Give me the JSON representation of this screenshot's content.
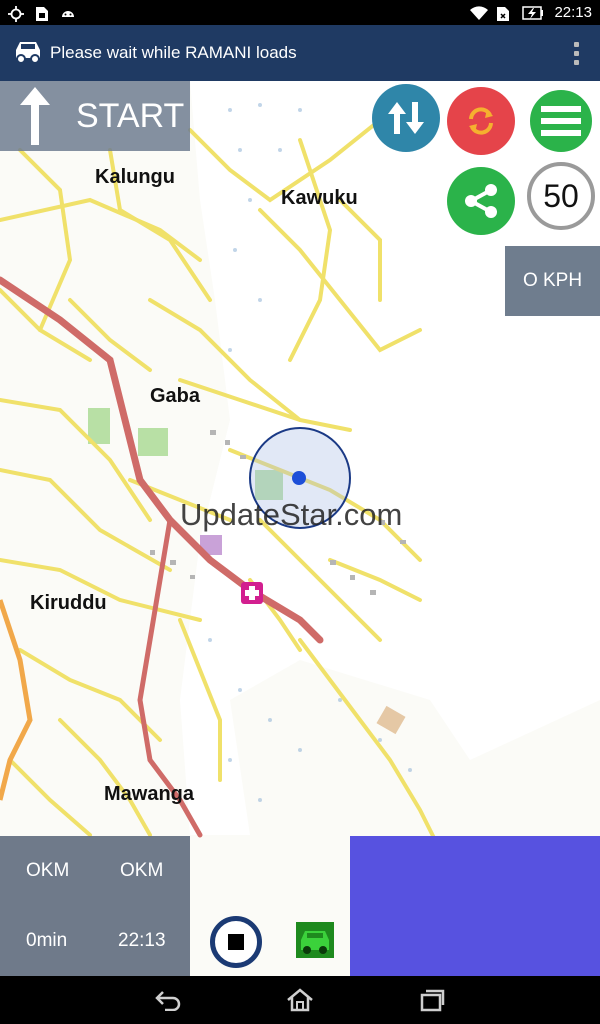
{
  "status_bar": {
    "time": "22:13",
    "icons_left": [
      "gps-icon",
      "sim-icon",
      "android-icon"
    ],
    "icons_right": [
      "wifi-icon",
      "sim-signal-icon",
      "battery-charging-icon"
    ]
  },
  "app_bar": {
    "title": "Please wait while RAMANI loads",
    "icon": "car-icon",
    "menu_icon": "overflow-menu-icon"
  },
  "controls": {
    "start_label": "START",
    "speed_limit": "50",
    "speed": "O KPH",
    "buttons": [
      "swap-arrows-icon",
      "refresh-icon",
      "hamburger-menu-icon",
      "share-icon"
    ]
  },
  "map": {
    "places": [
      "Kalungu",
      "Kawuku",
      "Gaba",
      "Kiruddu",
      "Mawanga"
    ],
    "watermark": "UpdateStar.com",
    "colors": {
      "road_major": "#d76b6b",
      "road_minor": "#f3e36a",
      "water": "#ffffff",
      "location": "#1d4fd8"
    }
  },
  "trip_panel": {
    "distance_left": "OKM",
    "distance_right": "OKM",
    "time_left": "0min",
    "time_right": "22:13"
  },
  "nav_bar": {
    "buttons": [
      "back-icon",
      "home-icon",
      "recents-icon"
    ]
  }
}
